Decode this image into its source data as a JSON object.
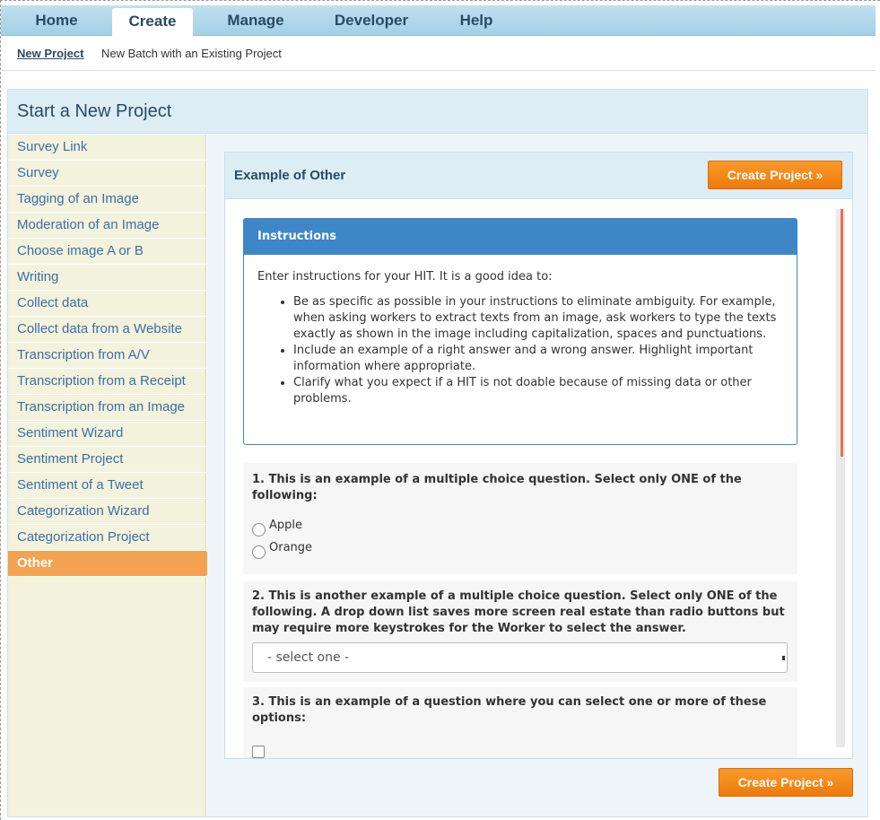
{
  "nav": {
    "tabs": [
      {
        "label": "Home"
      },
      {
        "label": "Create"
      },
      {
        "label": "Manage"
      },
      {
        "label": "Developer"
      },
      {
        "label": "Help"
      }
    ],
    "active_tab": "Create"
  },
  "subnav": {
    "items": [
      {
        "label": "New Project"
      },
      {
        "label": "New Batch with an Existing Project"
      }
    ]
  },
  "page": {
    "title": "Start a New Project"
  },
  "sidebar": {
    "items": [
      {
        "label": "Survey Link"
      },
      {
        "label": "Survey"
      },
      {
        "label": "Tagging of an Image"
      },
      {
        "label": "Moderation of an Image"
      },
      {
        "label": "Choose image A or B"
      },
      {
        "label": "Writing"
      },
      {
        "label": "Collect data"
      },
      {
        "label": "Collect data from a Website"
      },
      {
        "label": "Transcription from A/V"
      },
      {
        "label": "Transcription from a Receipt"
      },
      {
        "label": "Transcription from an Image"
      },
      {
        "label": "Sentiment Wizard"
      },
      {
        "label": "Sentiment Project"
      },
      {
        "label": "Sentiment of a Tweet"
      },
      {
        "label": "Categorization Wizard"
      },
      {
        "label": "Categorization Project"
      },
      {
        "label": "Other"
      }
    ],
    "active": "Other"
  },
  "panel": {
    "title": "Example of Other",
    "create_button": "Create Project »"
  },
  "instructions": {
    "heading": "Instructions",
    "intro": "Enter instructions for your HIT. It is a good idea to:",
    "bullets": [
      "Be as specific as possible in your instructions to eliminate ambiguity. For example, when asking workers to extract texts from an image, ask workers to type the texts exactly as shown in the image including capitalization, spaces and punctuations.",
      "Include an example of a right answer and a wrong answer. Highlight important information where appropriate.",
      "Clarify what you expect if a HIT is not doable because of missing data or other problems."
    ]
  },
  "questions": {
    "q1": {
      "text": "1. This is an example of a multiple choice question. Select only ONE of the following:",
      "options": [
        "Apple",
        "Orange"
      ]
    },
    "q2": {
      "text": "2. This is another example of a multiple choice question. Select only ONE of the following. A drop down list saves more screen real estate than radio buttons but may require more keystrokes for the Worker to select the answer.",
      "select_value": "- select one -"
    },
    "q3": {
      "text": "3. This is an example of a question where you can select one or more of these options:"
    }
  },
  "footer": {
    "create_button": "Create Project »"
  },
  "colors": {
    "accent_orange": "#ee7a0c",
    "nav_blue": "#a5cfe4",
    "link_blue": "#3b6fa8",
    "sidebar_bg": "#f3f2dc",
    "instructions_header": "#3d87c6"
  }
}
